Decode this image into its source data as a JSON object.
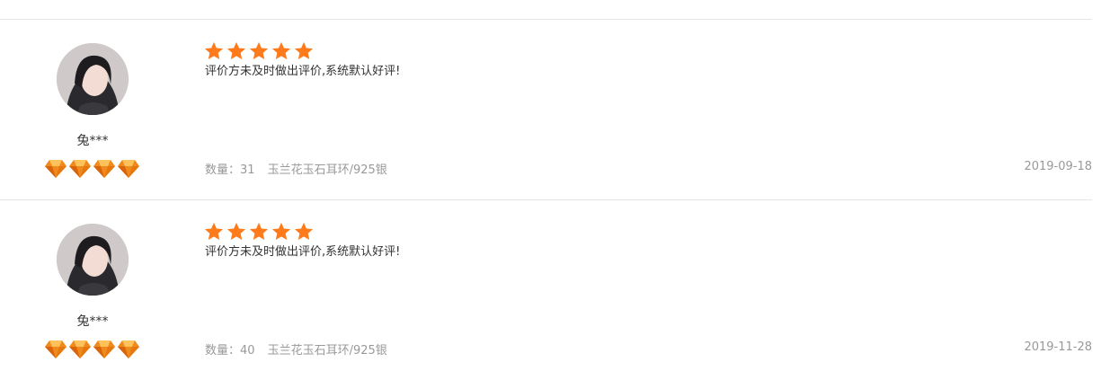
{
  "colors": {
    "star": "#ff7a1a",
    "diamond": "#f08a1c",
    "divider": "#e5e5e5",
    "meta_text": "#999999"
  },
  "reviews": [
    {
      "username": "兔***",
      "rating": 5,
      "member_level": 4,
      "comment": "评价方未及时做出评价,系统默认好评!",
      "quantity_label": "数量：",
      "quantity": "31",
      "product": "玉兰花玉石耳环/925银",
      "date": "2019-09-18",
      "avatar_icon": "user-avatar",
      "star_icon": "star-icon",
      "diamond_icon": "diamond-icon"
    },
    {
      "username": "兔***",
      "rating": 5,
      "member_level": 4,
      "comment": "评价方未及时做出评价,系统默认好评!",
      "quantity_label": "数量：",
      "quantity": "40",
      "product": "玉兰花玉石耳环/925银",
      "date": "2019-11-28",
      "avatar_icon": "user-avatar",
      "star_icon": "star-icon",
      "diamond_icon": "diamond-icon"
    }
  ]
}
